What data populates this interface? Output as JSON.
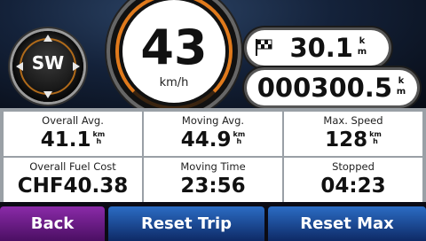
{
  "compass": {
    "heading": "SW"
  },
  "speed": {
    "value": "43",
    "unit": "km/h"
  },
  "trip_odometer": {
    "value": "30.1",
    "unit_top": "k",
    "unit_bottom": "m"
  },
  "odometer": {
    "value": "000300.5",
    "unit_top": "k",
    "unit_bottom": "m"
  },
  "stats": [
    {
      "label": "Overall Avg.",
      "value": "41.1",
      "unit_top": "km",
      "unit_bottom": "h"
    },
    {
      "label": "Moving Avg.",
      "value": "44.9",
      "unit_top": "km",
      "unit_bottom": "h"
    },
    {
      "label": "Max. Speed",
      "value": "128",
      "unit_top": "km",
      "unit_bottom": "h"
    },
    {
      "label": "Overall Fuel Cost",
      "value": "CHF40.38"
    },
    {
      "label": "Moving Time",
      "value": "23:56"
    },
    {
      "label": "Stopped",
      "value": "04:23"
    }
  ],
  "buttons": {
    "back": "Back",
    "reset_trip": "Reset Trip",
    "reset_max": "Reset Max"
  },
  "colors": {
    "accent_orange": "#e07a1c",
    "back_button": "#8a2aa8",
    "reset_button": "#2b6cc4"
  }
}
